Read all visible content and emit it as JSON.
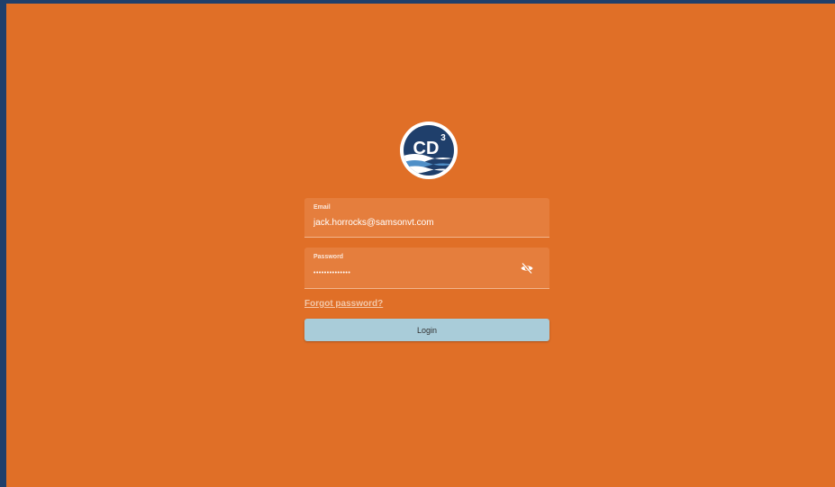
{
  "logo": {
    "text": "CD",
    "superscript": "3",
    "icon": "cd3-logo"
  },
  "email": {
    "label": "Email",
    "value": "jack.horrocks@samsonvt.com"
  },
  "password": {
    "label": "Password",
    "value": "••••••••••••••",
    "toggle_icon": "eye-off-icon"
  },
  "forgot_password": {
    "label": "Forgot password?"
  },
  "login_button": {
    "label": "Login"
  },
  "colors": {
    "background": "#e06f27",
    "frame": "#1f3f6b",
    "field": "#e57e3d",
    "button": "#a9ccd9",
    "logo_navy": "#1f3f6b"
  }
}
